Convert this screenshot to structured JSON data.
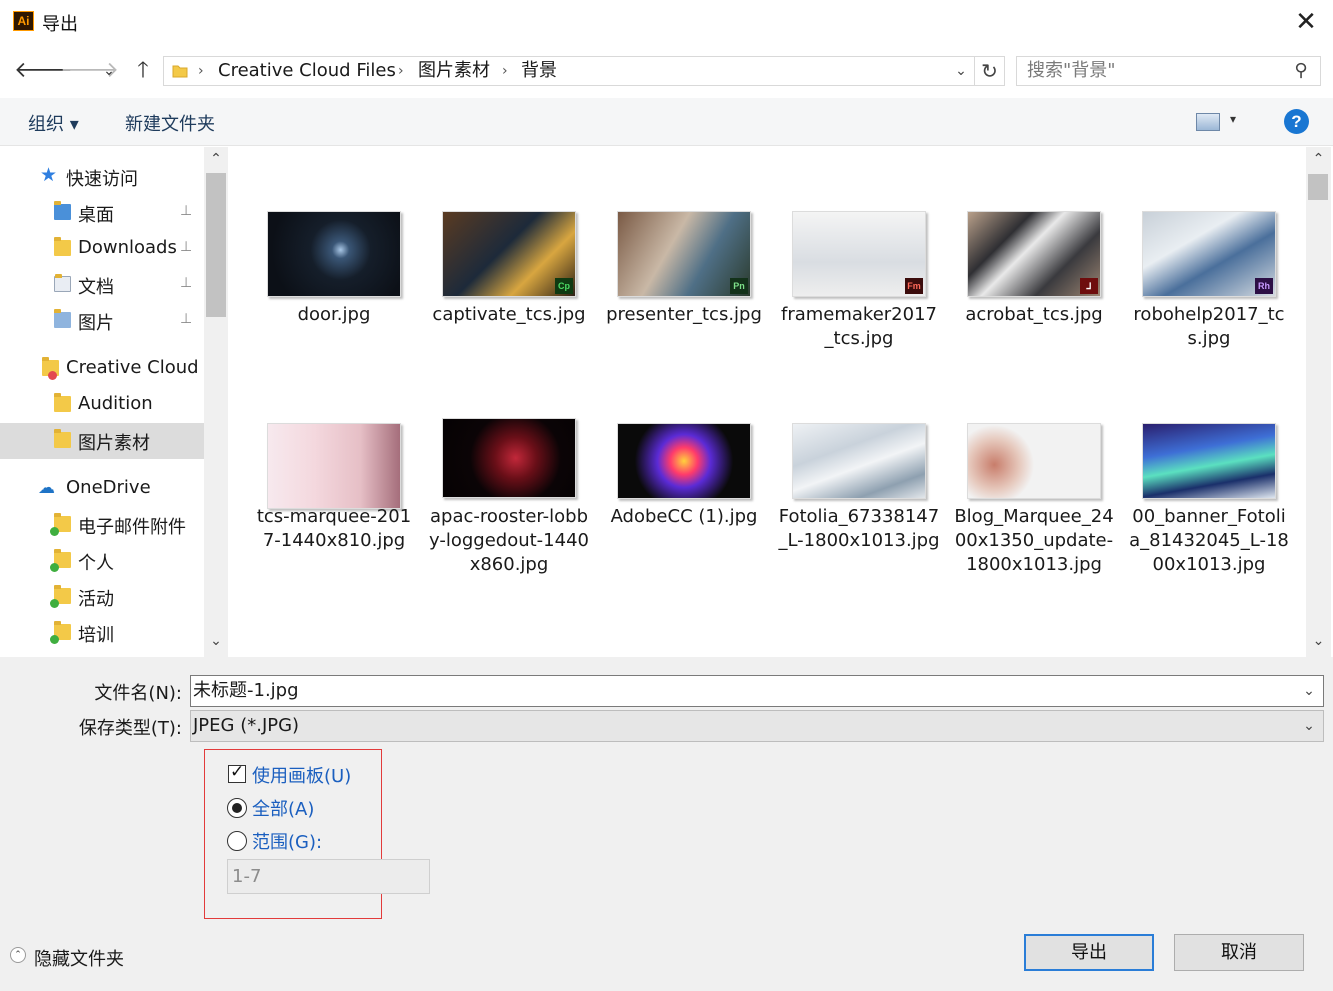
{
  "window": {
    "title": "导出",
    "app_icon_label": "Ai",
    "close_glyph": "✕"
  },
  "nav": {
    "back": "🡐",
    "forward": "🡒",
    "recent": "⌄",
    "up": "🡑"
  },
  "address": {
    "crumbs": [
      "Creative Cloud Files",
      "图片素材",
      "背景"
    ],
    "separator": "›",
    "refresh": "↻",
    "dropdown": "⌄"
  },
  "search": {
    "placeholder": "搜索\"背景\"",
    "icon": "⚲"
  },
  "toolbar": {
    "organize": "组织 ▾",
    "new_folder": "新建文件夹",
    "view_dropdown": "▾",
    "help": "?"
  },
  "sidebar": {
    "items": [
      {
        "label": "快速访问"
      },
      {
        "label": "桌面"
      },
      {
        "label": "Downloads"
      },
      {
        "label": "文档"
      },
      {
        "label": "图片"
      },
      {
        "label": "Creative Cloud Files"
      },
      {
        "label": "Audition"
      },
      {
        "label": "图片素材"
      },
      {
        "label": "OneDrive"
      },
      {
        "label": "电子邮件附件"
      },
      {
        "label": "个人"
      },
      {
        "label": "活动"
      },
      {
        "label": "培训"
      }
    ],
    "pin_glyph": "📌"
  },
  "scroll": {
    "up": "⌃",
    "down": "⌄"
  },
  "files": [
    {
      "name": "door.jpg",
      "badge": "",
      "badge_color": ""
    },
    {
      "name": "captivate_tcs.jpg",
      "badge": "Cp",
      "badge_color": "#2e7d32"
    },
    {
      "name": "presenter_tcs.jpg",
      "badge": "Pn",
      "badge_color": "#1b5e20"
    },
    {
      "name": "framemaker2017_tcs.jpg",
      "badge": "Fm",
      "badge_color": "#7a1d1d"
    },
    {
      "name": "acrobat_tcs.jpg",
      "badge": "⅃",
      "badge_color": "#8b1a1a"
    },
    {
      "name": "robohelp2017_tcs.jpg",
      "badge": "Rh",
      "badge_color": "#4a1a6b"
    },
    {
      "name": "tcs-marquee-2017-1440x810.jpg",
      "badge": "",
      "badge_color": ""
    },
    {
      "name": "apac-rooster-lobby-loggedout-1440x860.jpg",
      "badge": "",
      "badge_color": ""
    },
    {
      "name": "AdobeCC (1).jpg",
      "badge": "",
      "badge_color": ""
    },
    {
      "name": "Fotolia_67338147_L-1800x1013.jpg",
      "badge": "",
      "badge_color": ""
    },
    {
      "name": "Blog_Marquee_2400x1350_update-1800x1013.jpg",
      "badge": "",
      "badge_color": ""
    },
    {
      "name": "00_banner_Fotolia_81432045_L-1800x1013.jpg",
      "badge": "",
      "badge_color": ""
    }
  ],
  "form": {
    "filename_label": "文件名(N):",
    "filename_value": "未标题-1.jpg",
    "filetype_label": "保存类型(T):",
    "filetype_value": "JPEG (*.JPG)",
    "use_artboards": "使用画板(U)",
    "all": "全部(A)",
    "range": "范围(G):",
    "range_value": "1-7",
    "dropdown": "⌄"
  },
  "footer": {
    "hide_folders": "隐藏文件夹",
    "hide_icon": "⌃",
    "export": "导出",
    "cancel": "取消"
  },
  "colors": {
    "accent": "#1976d2",
    "highlight_box": "#e23b3b",
    "option_text": "#1b5fbf",
    "selected_nav": "#dcdcdc"
  }
}
